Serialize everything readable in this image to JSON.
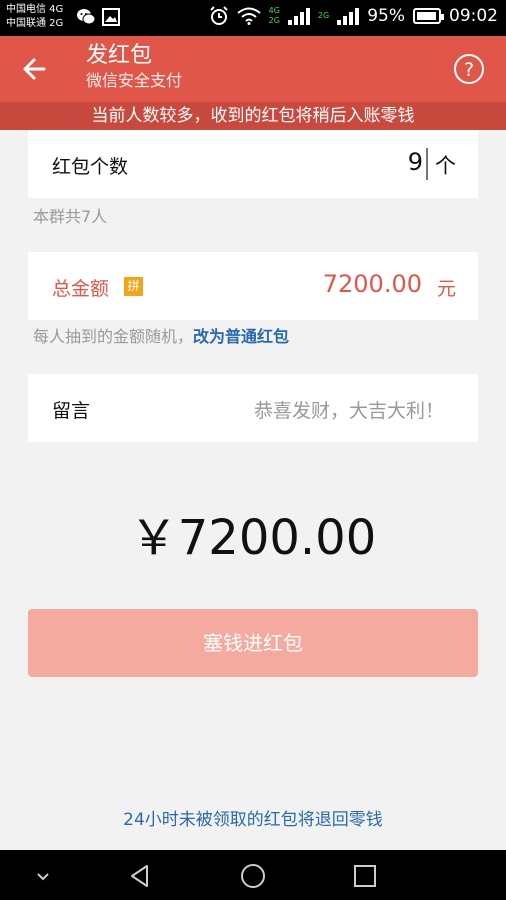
{
  "status_bar": {
    "carrier1": "中国电信 4G",
    "carrier2": "中国联通 2G",
    "net_a": "4G",
    "net_b": "2G",
    "net_c": "2G",
    "battery_percent": "95%",
    "battery_level": 0.95,
    "time": "09:02"
  },
  "header": {
    "title": "发红包",
    "subtitle": "微信安全支付",
    "accent_color": "#e0574a"
  },
  "notice": "当前人数较多，收到的红包将稍后入账零钱",
  "count_card": {
    "label": "红包个数",
    "value": "9",
    "unit": "个"
  },
  "group_hint": "本群共7人",
  "amount_card": {
    "label": "总金额",
    "badge": "拼",
    "value": "7200.00",
    "unit": "元"
  },
  "random_hint": {
    "text": "每人抽到的金额随机，",
    "link": "改为普通红包"
  },
  "message_card": {
    "label": "留言",
    "placeholder": "恭喜发财，大吉大利！"
  },
  "total_display": "￥7200.00",
  "submit_label": "塞钱进红包",
  "footer_note": "24小时未被领取的红包将退回零钱",
  "icons": {
    "back": "arrow-left-icon",
    "help": "question-circle-icon"
  }
}
